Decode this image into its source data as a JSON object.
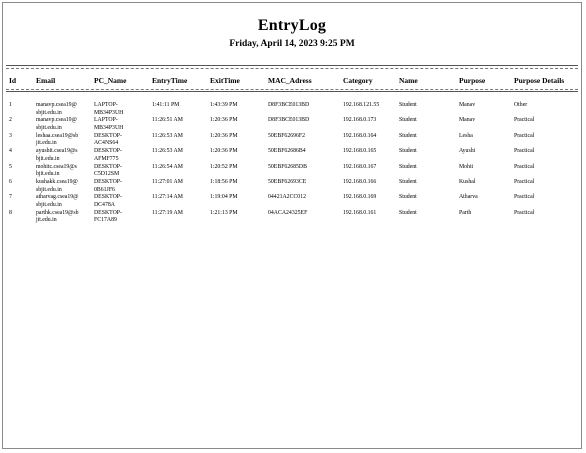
{
  "report": {
    "title": "EntryLog",
    "date": "Friday, April 14, 2023 9:25 PM"
  },
  "table": {
    "headers": [
      "Id",
      "Email",
      "PC_Name",
      "EntryTime",
      "ExitTime",
      "MAC_Adress",
      "Category",
      "Name",
      "Purpose",
      "Purpose Details"
    ],
    "rows": [
      {
        "id": "1",
        "email": "manavp.csea19@\nsbjit.edu.in",
        "pc": "LAPTOP-\nMB34P3UH",
        "entry": "1:41:11 PM",
        "exit": "1:43:39 PM",
        "mac": "D8F3BCE013BD",
        "ip": "192.168.121.55",
        "category": "Student",
        "name": "Manav",
        "purpose": "Other"
      },
      {
        "id": "2",
        "email": "manavp.csea19@\nsbjit.edu.in",
        "pc": "LAPTOP-\nMB34P3UH",
        "entry": "11:26:51 AM",
        "exit": "1:20:36 PM",
        "mac": "D8F3BCE013BD",
        "ip": "192.168.0.173",
        "category": "Student",
        "name": "Manav",
        "purpose": "Practical"
      },
      {
        "id": "3",
        "email": "leshaa.csea19@sb\njit.edu.in",
        "pc": "DESKTOP-\nAC4NS64",
        "entry": "11:26:53 AM",
        "exit": "1:20:36 PM",
        "mac": "50EBF62696F2",
        "ip": "192.168.0.164",
        "category": "Student",
        "name": "Lesha",
        "purpose": "Practical"
      },
      {
        "id": "4",
        "email": "ayushit.csea19@s\nbjit.edu.in",
        "pc": "DESKTOP-\nAFMF775",
        "entry": "11:26:53 AM",
        "exit": "1:20:36 PM",
        "mac": "50EBF62686B4",
        "ip": "192.168.0.165",
        "category": "Student",
        "name": "Ayushi",
        "purpose": "Practical"
      },
      {
        "id": "5",
        "email": "mohitc.csea19@s\nbjit.edu.in",
        "pc": "DESKTOP-\nC5D12SM",
        "entry": "11:26:54 AM",
        "exit": "1:20:52 PM",
        "mac": "50EBF62685DB",
        "ip": "192.168.0.167",
        "category": "Student",
        "name": "Mohit",
        "purpose": "Practical"
      },
      {
        "id": "6",
        "email": "kushakk.csea19@\nsbjit.edu.in",
        "pc": "DESKTOP-\n0B61JF6",
        "entry": "11:27:01 AM",
        "exit": "1:18:56 PM",
        "mac": "50EBF62693CE",
        "ip": "192.168.0.166",
        "category": "Student",
        "name": "Kushal",
        "purpose": "Practical"
      },
      {
        "id": "7",
        "email": "atharvag.csea19@\nsbjit.edu.in",
        "pc": "DESKTOP-\nDC478A",
        "entry": "11:27:14 AM",
        "exit": "1:19:04 PM",
        "mac": "04421A2CC012",
        "ip": "192.168.0.169",
        "category": "Student",
        "name": "Atharva",
        "purpose": "Practical"
      },
      {
        "id": "8",
        "email": "parthk.csea19@sb\njit.edu.in",
        "pc": "DESKTOP-\nFC17A89",
        "entry": "11:27:19 AM",
        "exit": "1:21:13 PM",
        "mac": "04ACA24325EF",
        "ip": "192.168.0.161",
        "category": "Student",
        "name": "Parth",
        "purpose": "Practical"
      }
    ]
  }
}
